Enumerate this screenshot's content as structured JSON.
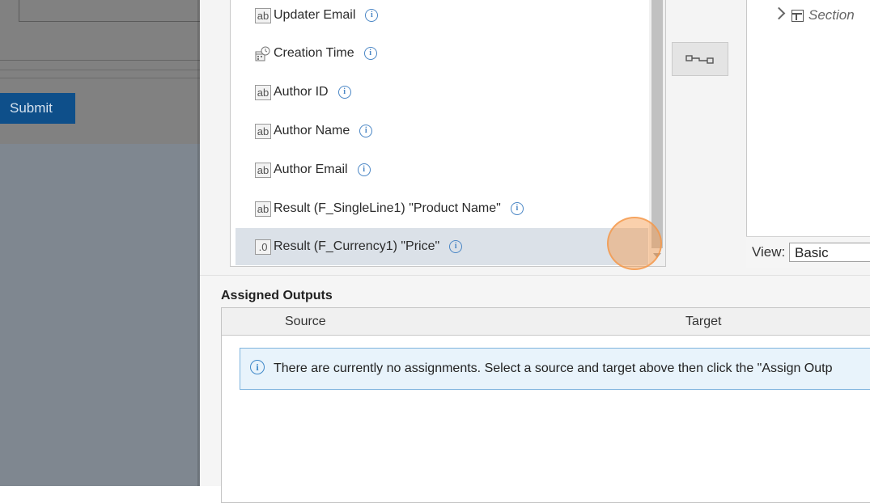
{
  "background": {
    "submit_label": "Submit"
  },
  "source_list": {
    "items": [
      {
        "label": "Updater Email",
        "icon": "ab",
        "type": "text-field-icon"
      },
      {
        "label": "Creation Time",
        "icon": "",
        "type": "datetime-field-icon"
      },
      {
        "label": "Author ID",
        "icon": "ab",
        "type": "text-field-icon"
      },
      {
        "label": "Author Name",
        "icon": "ab",
        "type": "text-field-icon"
      },
      {
        "label": "Author Email",
        "icon": "ab",
        "type": "text-field-icon"
      },
      {
        "label": "Result (F_SingleLine1) \"Product Name\"",
        "icon": "ab",
        "type": "text-field-icon"
      },
      {
        "label": "Result (F_Currency1) \"Price\"",
        "icon": ".0",
        "type": "number-field-icon",
        "selected": true
      }
    ]
  },
  "target_tree": {
    "section_label": "Section",
    "view_label": "View:",
    "view_value": "Basic"
  },
  "assigned_outputs": {
    "title": "Assigned Outputs",
    "columns": [
      "Source",
      "Target"
    ],
    "empty_message": "There are currently no assignments. Select a source and target above then click the \"Assign Outp"
  },
  "colors": {
    "accent": "#4a86c5",
    "submit_bg": "#0e4f8a",
    "selected_row": "#dbe1e8",
    "click_highlight": "#f59646"
  }
}
